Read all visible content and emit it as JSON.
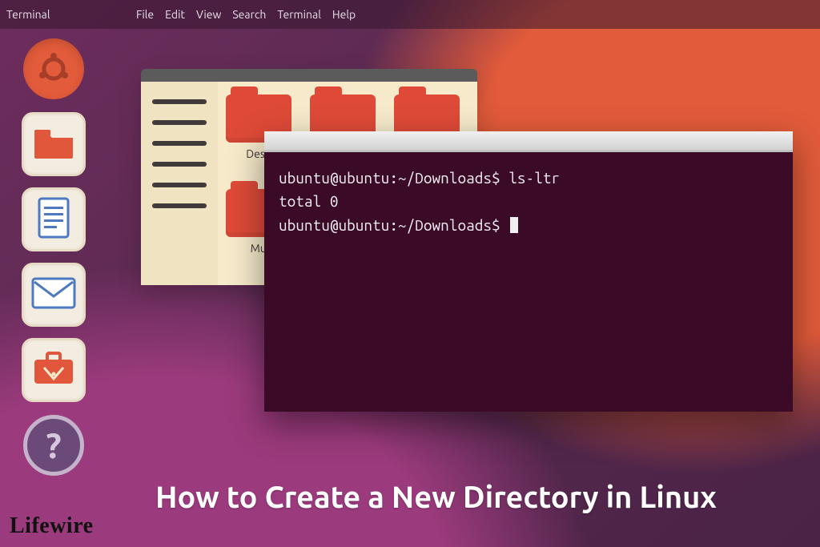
{
  "topbar": {
    "app_name": "Terminal"
  },
  "menubar": {
    "items": [
      "File",
      "Edit",
      "View",
      "Search",
      "Terminal",
      "Help"
    ]
  },
  "launcher": {
    "items": [
      {
        "name": "dash-home",
        "kind": "dash"
      },
      {
        "name": "files",
        "kind": "tile",
        "icon": "folder"
      },
      {
        "name": "document",
        "kind": "tile",
        "icon": "document"
      },
      {
        "name": "mail",
        "kind": "tile",
        "icon": "mail"
      },
      {
        "name": "software",
        "kind": "tile",
        "icon": "briefcase"
      },
      {
        "name": "help",
        "kind": "help",
        "label": "?"
      }
    ]
  },
  "file_manager": {
    "folders": [
      {
        "label": "Desk"
      },
      {
        "label": ""
      },
      {
        "label": ""
      },
      {
        "label": "Mu"
      },
      {
        "label": ""
      },
      {
        "label": ""
      }
    ]
  },
  "terminal": {
    "lines": [
      "ubuntu@ubuntu:~/Downloads$ ls-ltr",
      "total 0",
      "ubuntu@ubuntu:~/Downloads$ "
    ],
    "cursor_after_last": true
  },
  "headline": "How to Create a New Directory in Linux",
  "brand": "Lifewire",
  "colors": {
    "accent_orange": "#e25b3a",
    "accent_purple": "#6e2d5d",
    "terminal_bg": "#3a0a26",
    "tile_bg": "#f3ece0"
  }
}
